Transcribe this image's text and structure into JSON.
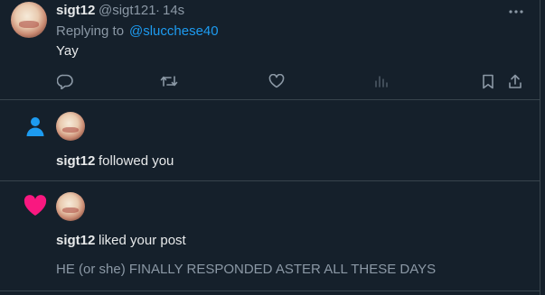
{
  "tweet": {
    "display_name": "sigt12",
    "handle": "@sigt121",
    "separator": "·",
    "time": "14s",
    "replying_prefix": "Replying to",
    "replying_to": "@slucchese40",
    "body": "Yay",
    "more_icon": "ellipsis-icon",
    "actions": [
      "reply-icon",
      "retweet-icon",
      "like-icon",
      "views-icon",
      "bookmark-icon",
      "share-icon"
    ]
  },
  "follow_notification": {
    "icon": "person-icon",
    "actor": "sigt12",
    "action_text": "followed you"
  },
  "like_notification": {
    "icon": "heart-icon",
    "actor": "sigt12",
    "action_text": "liked your post",
    "post_text": "HE (or she) FINALLY RESPONDED ASTER ALL THESE DAYS"
  },
  "colors": {
    "background": "#15202b",
    "border": "#38444d",
    "text_primary": "#e7e9ea",
    "text_secondary": "#8b98a5",
    "link": "#1d9bf0",
    "follow_icon": "#1d9bf0",
    "like_icon": "#f91880"
  }
}
